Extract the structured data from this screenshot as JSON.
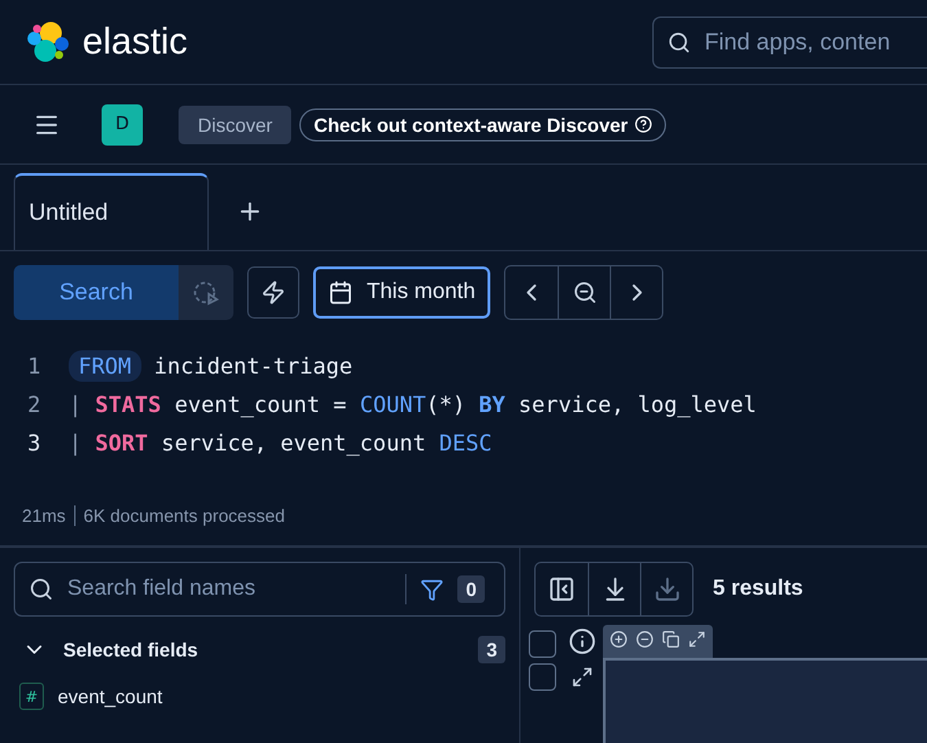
{
  "header": {
    "brand": "elastic",
    "search": {
      "placeholder": "Find apps, conten"
    }
  },
  "breadcrumbs": {
    "space_initial": "D",
    "current": "Discover",
    "promo": "Check out context-aware Discover"
  },
  "tabs": [
    {
      "label": "Untitled",
      "selected": true
    }
  ],
  "toolbar": {
    "search_button": "Search",
    "date_label": "This month"
  },
  "query": {
    "lines": [
      {
        "number": "1",
        "tokens": [
          {
            "kind": "source",
            "text": "FROM"
          },
          {
            "kind": "text",
            "text": " incident-triage"
          }
        ]
      },
      {
        "number": "2",
        "tokens": [
          {
            "kind": "pipe",
            "text": "| "
          },
          {
            "kind": "command",
            "text": "STATS"
          },
          {
            "kind": "text",
            "text": " event_count = "
          },
          {
            "kind": "function",
            "text": "COUNT"
          },
          {
            "kind": "text",
            "text": "(*) "
          },
          {
            "kind": "clause",
            "text": "BY"
          },
          {
            "kind": "text",
            "text": " service, log_level"
          }
        ]
      },
      {
        "number": "3",
        "tokens": [
          {
            "kind": "pipe",
            "text": "| "
          },
          {
            "kind": "command",
            "text": "SORT"
          },
          {
            "kind": "text",
            "text": " service, event_count "
          },
          {
            "kind": "function",
            "text": "DESC"
          }
        ]
      }
    ]
  },
  "status": {
    "duration": "21ms",
    "documents": "6K documents processed"
  },
  "sidebar": {
    "search": {
      "placeholder": "Search field names"
    },
    "filter_count": "0",
    "sections": [
      {
        "title": "Selected fields",
        "count": "3",
        "expanded": true,
        "fields": [
          {
            "type_symbol": "#",
            "name": "event_count"
          }
        ]
      }
    ]
  },
  "results": {
    "count": "5 results",
    "select_all_checked": false,
    "rows": [
      {
        "checked": false
      }
    ]
  }
}
